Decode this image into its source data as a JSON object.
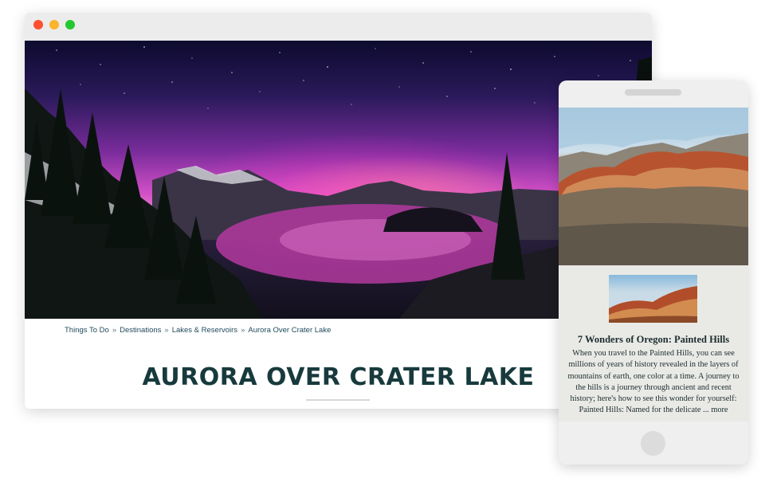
{
  "desktop": {
    "breadcrumb": {
      "items": [
        "Things To Do",
        "Destinations",
        "Lakes & Reservoirs",
        "Aurora Over Crater Lake"
      ],
      "separator": "»"
    },
    "title": "AURORA OVER CRATER LAKE",
    "colors": {
      "title": "#183a3d",
      "breadcrumb": "#1f4a5c",
      "window_close": "#fe4f2f",
      "window_minimize": "#fbb42b",
      "window_maximize": "#23c930"
    }
  },
  "mobile": {
    "card": {
      "title": "7 Wonders of Oregon: Painted Hills",
      "body": "When you travel to the Painted Hills, you can see millions of years of history revealed in the layers of mountains of earth, one color at a time. A journey to the hills is a journey through ancient and recent history; here's how to see this wonder for yourself: Painted Hills: Named for the delicate ... more"
    }
  }
}
